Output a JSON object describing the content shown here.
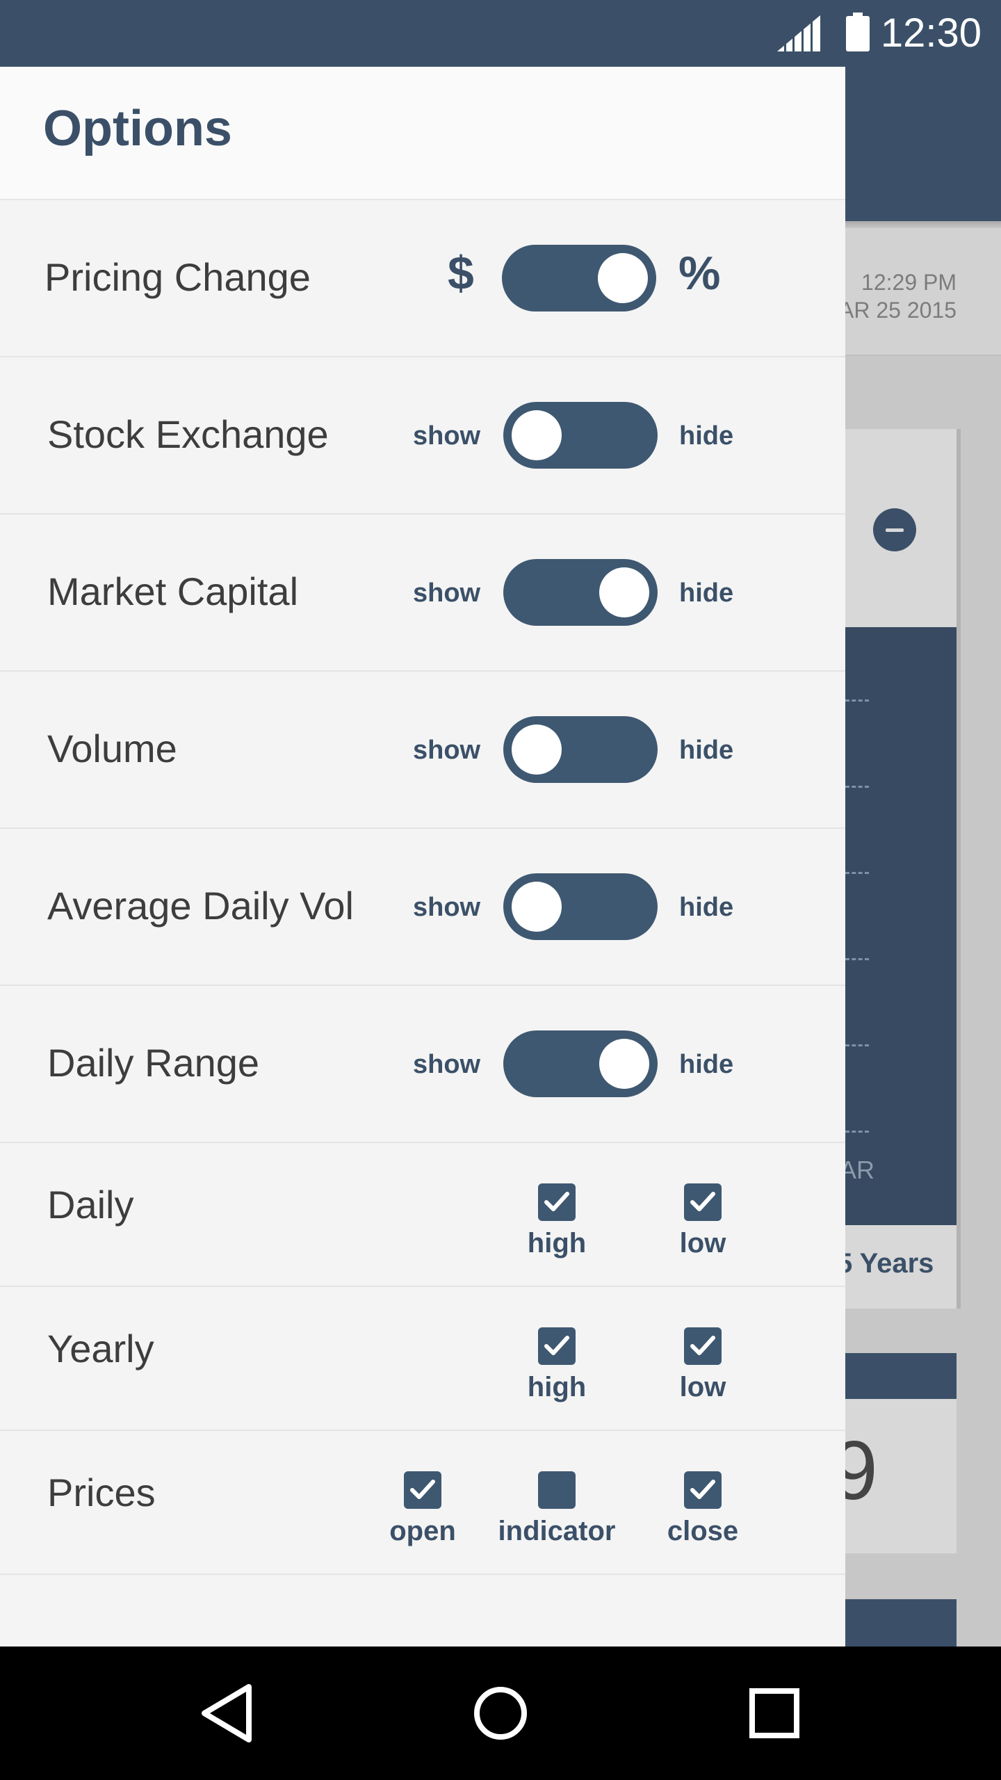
{
  "status_bar": {
    "time": "12:30"
  },
  "background": {
    "time": "12:29 PM",
    "date": "AR 25 2015",
    "chart_label": "AR",
    "years_label": "5 Years",
    "big_digit": "9"
  },
  "drawer": {
    "title": "Options",
    "toggle_rows": [
      {
        "label": "Pricing Change",
        "left": "$",
        "right": "%",
        "on": true
      },
      {
        "label": "Stock Exchange",
        "left": "show",
        "right": "hide",
        "on": false
      },
      {
        "label": "Market Capital",
        "left": "show",
        "right": "hide",
        "on": true
      },
      {
        "label": "Volume",
        "left": "show",
        "right": "hide",
        "on": false
      },
      {
        "label": "Average Daily Vol",
        "left": "show",
        "right": "hide",
        "on": false
      },
      {
        "label": "Daily Range",
        "left": "show",
        "right": "hide",
        "on": true
      }
    ],
    "check_rows": [
      {
        "label": "Daily",
        "options": [
          {
            "label": "high",
            "checked": true
          },
          {
            "label": "low",
            "checked": true
          }
        ]
      },
      {
        "label": "Yearly",
        "options": [
          {
            "label": "high",
            "checked": true
          },
          {
            "label": "low",
            "checked": true
          }
        ]
      },
      {
        "label": "Prices",
        "options": [
          {
            "label": "open",
            "checked": true
          },
          {
            "label": "indicator",
            "checked": false
          },
          {
            "label": "close",
            "checked": true
          }
        ]
      }
    ]
  },
  "nav_bar": {
    "icons": [
      "back-icon",
      "home-icon",
      "recents-icon"
    ]
  },
  "colors": {
    "primary": "#3b5068",
    "toggle": "#3f5871",
    "drawer_bg": "#f4f4f4"
  }
}
